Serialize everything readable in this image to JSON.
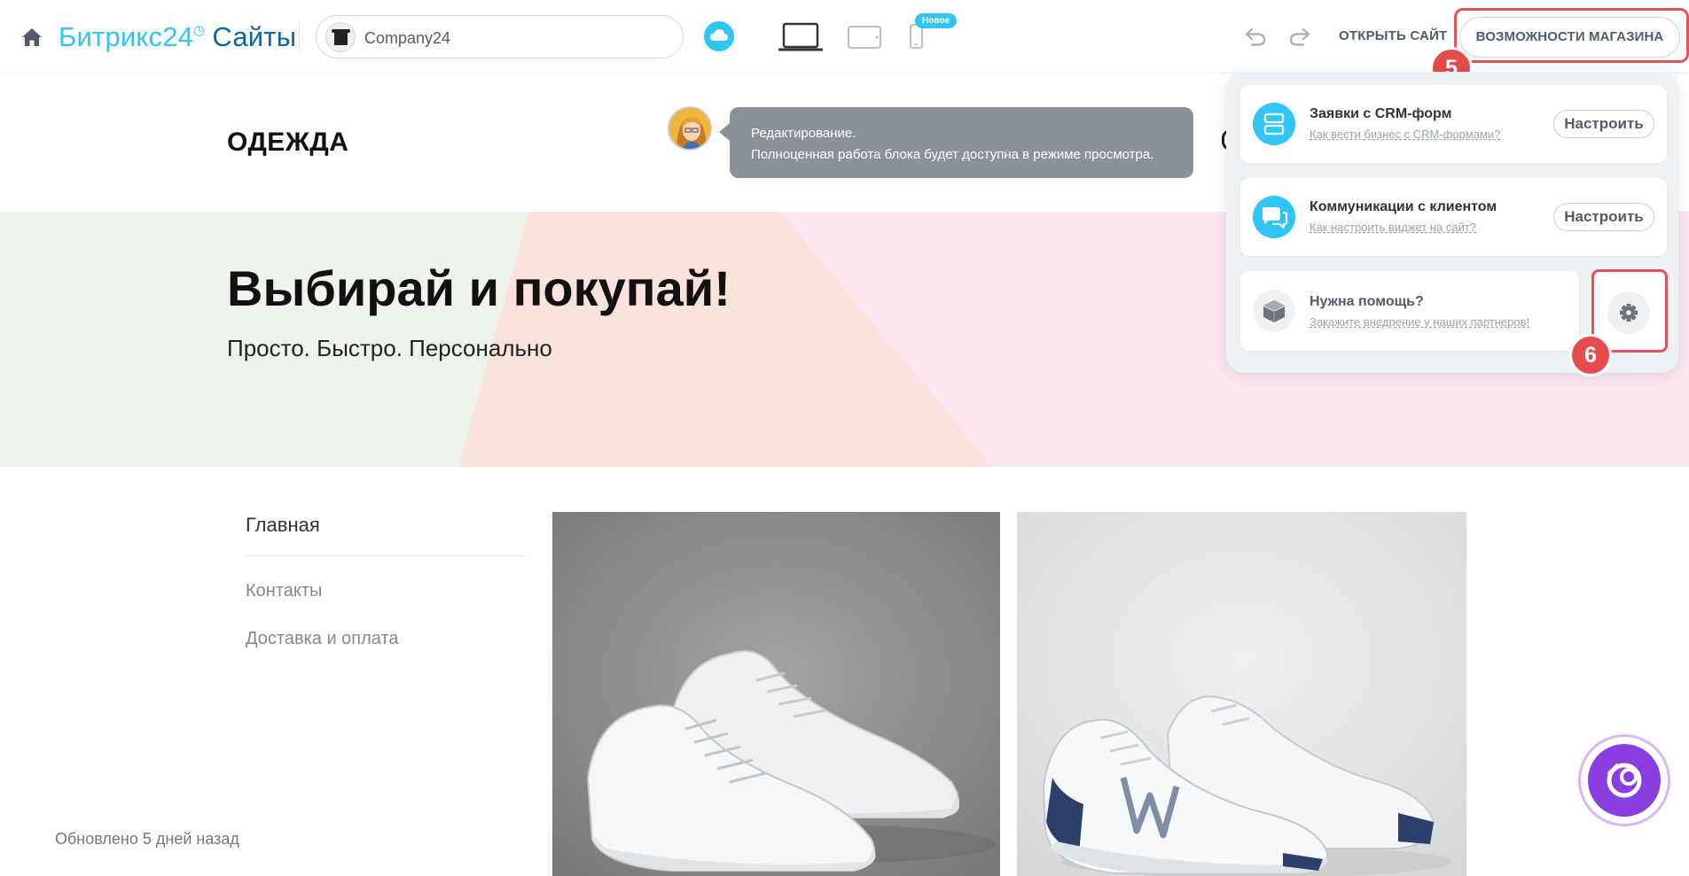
{
  "topbar": {
    "logo_brand": "Битрикс24",
    "logo_product": "Сайты",
    "site_name": "Company24",
    "new_badge": "Новое",
    "open_site": "ОТКРЫТЬ САЙТ",
    "shop_features": "ВОЗМОЖНОСТИ МАГАЗИНА"
  },
  "site": {
    "brand": "ОДЕЖДА",
    "tooltip_line1": "Редактирование.",
    "tooltip_line2": "Полноценная работа блока будет доступна в режиме просмотра.",
    "hero_title": "Выбирай и покупай!",
    "hero_subtitle": "Просто. Быстро. Персонально",
    "nav": [
      "Главная",
      "Контакты",
      "Доставка и оплата"
    ],
    "updated": "Обновлено 5 дней назад"
  },
  "panel": {
    "cards": [
      {
        "title": "Заявки с CRM-форм",
        "link": "Как вести бизнес с CRM-формами?",
        "button": "Настроить",
        "icon": "crm-forms-icon",
        "color": "#2fc6f6"
      },
      {
        "title": "Коммуникации с клиентом",
        "link": "Как настроить виджет на сайт?",
        "button": "Настроить",
        "icon": "chat-icon",
        "color": "#2fc6f6"
      },
      {
        "title": "Нужна помощь?",
        "link": "Закажите внедрение у наших партнеров!",
        "icon": "box-icon",
        "color": "#eef1f3"
      }
    ]
  },
  "annotations": {
    "step5": "5",
    "step6": "6",
    "highlight_color": "#e0535a"
  }
}
